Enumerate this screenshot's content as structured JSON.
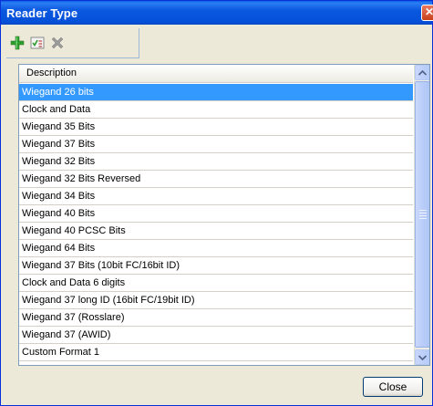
{
  "window": {
    "title": "Reader Type",
    "close_glyph": "✕"
  },
  "toolbar": {
    "add_icon": "green-plus-icon",
    "check_icon": "checklist-icon",
    "delete_icon": "gray-x-icon"
  },
  "list": {
    "header": "Description",
    "selected_index": 0,
    "rows": [
      "Wiegand 26 bits",
      "Clock and Data",
      "Wiegand 35 Bits",
      "Wiegand 37 Bits",
      "Wiegand 32 Bits",
      "Wiegand 32 Bits Reversed",
      "Wiegand 34 Bits",
      "Wiegand 40 Bits",
      "Wiegand 40 PCSC Bits",
      "Wiegand 64 Bits",
      "Wiegand 37 Bits (10bit FC/16bit ID)",
      "Clock and Data 6 digits",
      "Wiegand 37 long ID (16bit FC/19bit ID)",
      "Wiegand 37 (Rosslare)",
      "Wiegand 37 (AWID)",
      "Custom Format 1"
    ]
  },
  "footer": {
    "close_label": "Close"
  },
  "colors": {
    "selection": "#3399ff",
    "title_bar": "#0a58e0"
  }
}
